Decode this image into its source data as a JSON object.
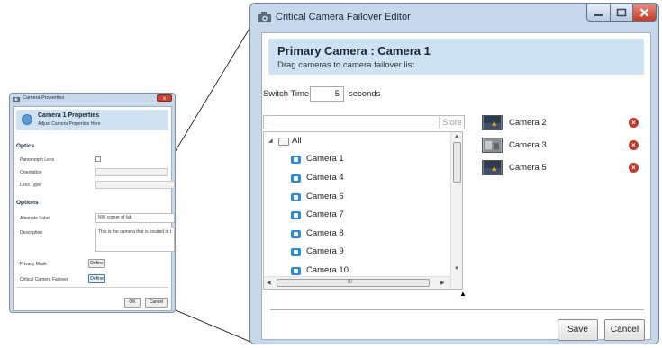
{
  "camera_properties": {
    "window_title": "Camera Properties",
    "close_glyph": "x",
    "header_title": "Camera 1 Properties",
    "header_subtitle": "Adjust Camera Properties Here",
    "optics_heading": "Optics",
    "panomorph_label": "Panomorph Lens",
    "orientation_label": "Orientation",
    "lens_type_label": "Lens Type",
    "options_heading": "Options",
    "alternate_label_label": "Alternate Label",
    "alternate_label_value": "NW corner of lab",
    "description_label": "Description",
    "description_value": "This is the camera that is located in t",
    "privacy_mask_label": "Privacy Mask",
    "privacy_mask_button": "Define",
    "failover_label": "Critical Camera Failover",
    "failover_button": "Define",
    "ok_button": "OK",
    "cancel_button": "Cancel"
  },
  "editor": {
    "window_title": "Critical Camera Failover Editor",
    "header_title": "Primary Camera : Camera 1",
    "header_subtitle": "Drag cameras to camera failover list",
    "switch_time_label": "Switch Time",
    "switch_time_value": "5",
    "switch_time_unit": "seconds",
    "search_placeholder": "Store",
    "tree_root": "All",
    "tree_cameras": [
      "Camera 1",
      "Camera 4",
      "Camera 6",
      "Camera 7",
      "Camera 8",
      "Camera 9",
      "Camera 10"
    ],
    "hscroll_grip": "III",
    "failover_list": [
      "Camera 2",
      "Camera 3",
      "Camera 5"
    ],
    "save_button": "Save",
    "cancel_button": "Cancel"
  },
  "colors": {
    "window_frame": "#c7d8ec",
    "header_band": "#cfe2f3",
    "camera_icon": "#2d8ad6",
    "remove_icon": "#c0392b"
  }
}
